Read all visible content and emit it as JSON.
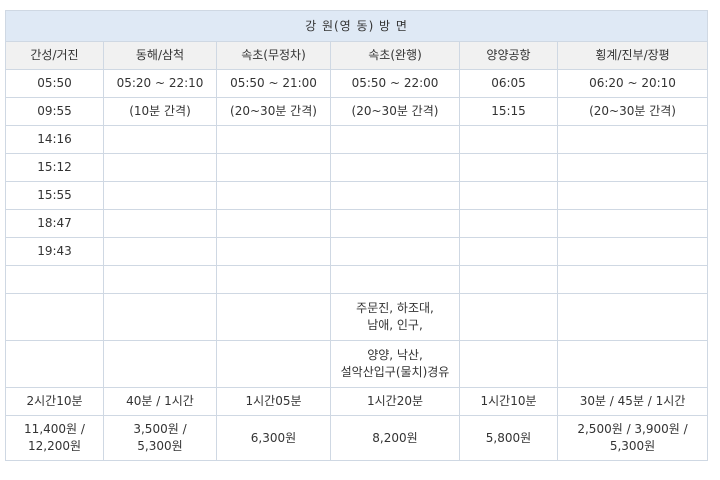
{
  "title": "강 원(영 동) 방 면",
  "columns": [
    "간성/거진",
    "동해/삼척",
    "속초(무정차)",
    "속초(완행)",
    "양양공항",
    "횡계/진부/장평"
  ],
  "time_rows": [
    [
      "05:50",
      "05:20 ~ 22:10",
      "05:50 ~ 21:00",
      "05:50 ~ 22:00",
      "06:05",
      "06:20 ~ 20:10"
    ],
    [
      "09:55",
      "(10분 간격)",
      "(20~30분 간격)",
      "(20~30분 간격)",
      "15:15",
      "(20~30분 간격)"
    ],
    [
      "14:16",
      "",
      "",
      "",
      "",
      ""
    ],
    [
      "15:12",
      "",
      "",
      "",
      "",
      ""
    ],
    [
      "15:55",
      "",
      "",
      "",
      "",
      ""
    ],
    [
      "18:47",
      "",
      "",
      "",
      "",
      ""
    ],
    [
      "19:43",
      "",
      "",
      "",
      "",
      ""
    ],
    [
      "",
      "",
      "",
      "",
      "",
      ""
    ]
  ],
  "stops_rows": [
    [
      "",
      "",
      "",
      "주문진, 하조대,\n남애, 인구,",
      "",
      ""
    ],
    [
      "",
      "",
      "",
      "양양, 낙산,\n설악산입구(물치)경유",
      "",
      ""
    ]
  ],
  "duration_row": [
    "2시간10분",
    "40분 / 1시간",
    "1시간05분",
    "1시간20분",
    "1시간10분",
    "30분 / 45분 / 1시간"
  ],
  "fare_row": [
    "11,400원 /\n12,200원",
    "3,500원 /\n5,300원",
    "6,300원",
    "8,200원",
    "5,800원",
    "2,500원 / 3,900원 /\n5,300원"
  ]
}
